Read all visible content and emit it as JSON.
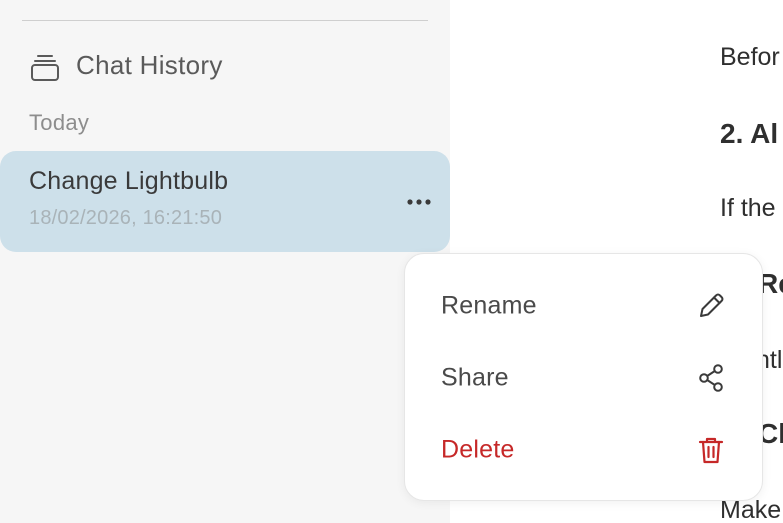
{
  "sidebar": {
    "history_title": "Chat History",
    "history_icon": "stacked-layers-icon",
    "section_label": "Today",
    "chats": [
      {
        "title": "Change Lightbulb",
        "timestamp": "18/02/2026, 16:21:50",
        "more_icon": "more-horizontal-icon",
        "selected": true
      }
    ]
  },
  "main": {
    "lines": [
      "Befor",
      "2. Al",
      "If the",
      "Re",
      "ntl",
      "Cl",
      "Make"
    ]
  },
  "context_menu": {
    "items": [
      {
        "label": "Rename",
        "icon": "pencil-icon"
      },
      {
        "label": "Share",
        "icon": "share-icon"
      },
      {
        "label": "Delete",
        "icon": "trash-icon",
        "color": "#c62828"
      }
    ]
  },
  "colors": {
    "sidebar_bg": "#f6f6f6",
    "selected_item_bg": "#cde0ea",
    "danger": "#c62828"
  }
}
